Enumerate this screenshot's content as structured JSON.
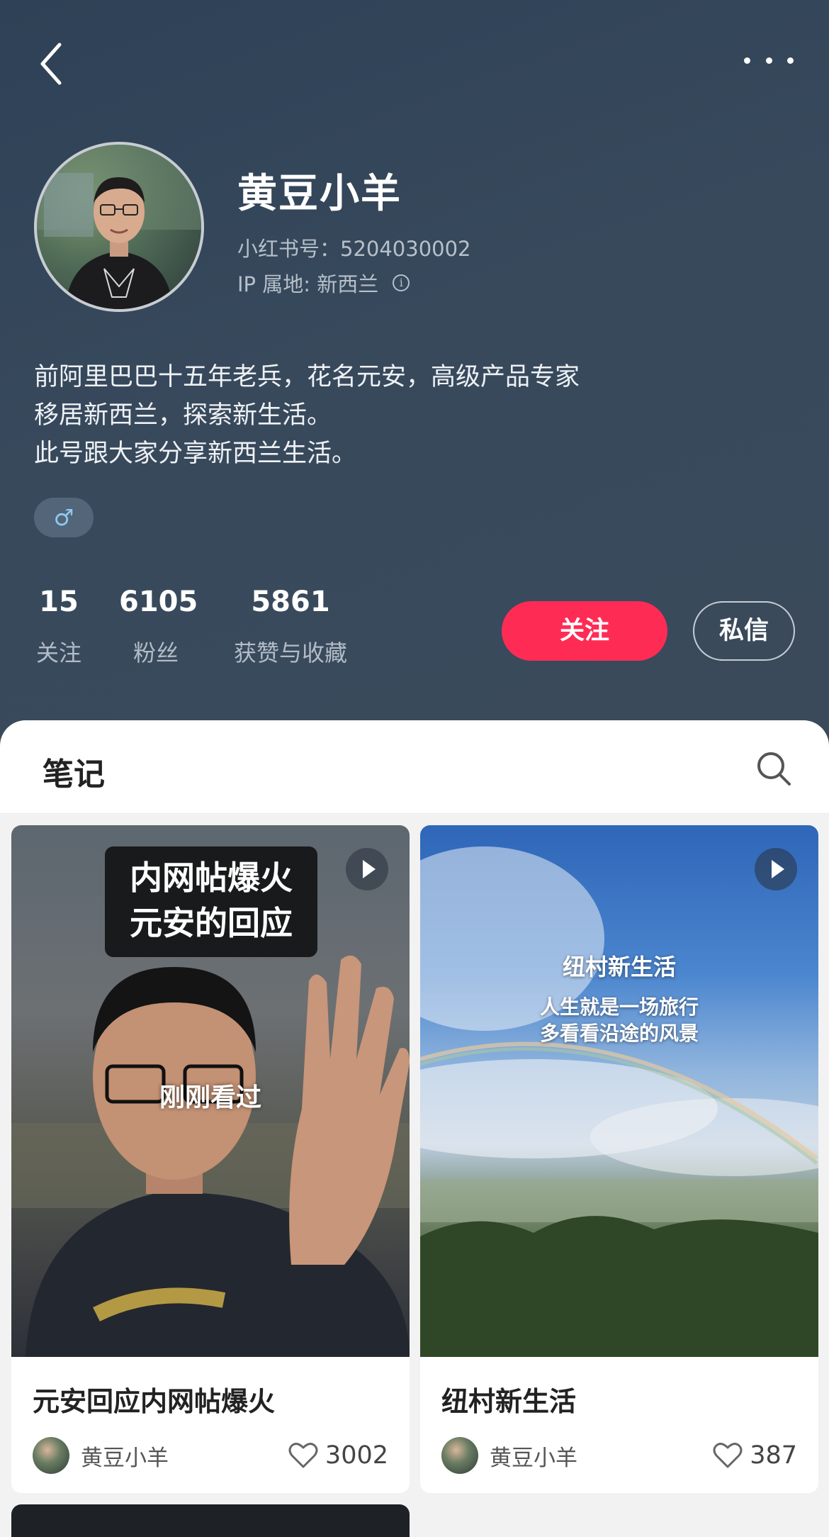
{
  "profile": {
    "name": "黄豆小羊",
    "red_id": "小红书号：5204030002",
    "ip_location": "IP 属地: 新西兰",
    "bio_lines": [
      "前阿里巴巴十五年老兵，花名元安，高级产品专家",
      "移居新西兰，探索新生活。",
      "此号跟大家分享新西兰生活。"
    ],
    "gender_symbol": "♂"
  },
  "stats": [
    {
      "value": "15",
      "label": "关注"
    },
    {
      "value": "6105",
      "label": "粉丝"
    },
    {
      "value": "5861",
      "label": "获赞与收藏"
    }
  ],
  "actions": {
    "follow": "关注",
    "message": "私信"
  },
  "tab": {
    "notes": "笔记"
  },
  "notes": [
    {
      "overlay_lines": [
        "内网帖爆火",
        "元安的回应"
      ],
      "badge": "刚刚看过",
      "title": "元安回应内网帖爆火",
      "author": "黄豆小羊",
      "likes": "3002"
    },
    {
      "overlay_title": "纽村新生活",
      "overlay_lines": [
        "人生就是一场旅行",
        "多看看沿途的风景"
      ],
      "title": "纽村新生活",
      "author": "黄豆小羊",
      "likes": "387"
    }
  ],
  "colors": {
    "accent": "#fe2c55",
    "header_bg": "#34465a"
  }
}
